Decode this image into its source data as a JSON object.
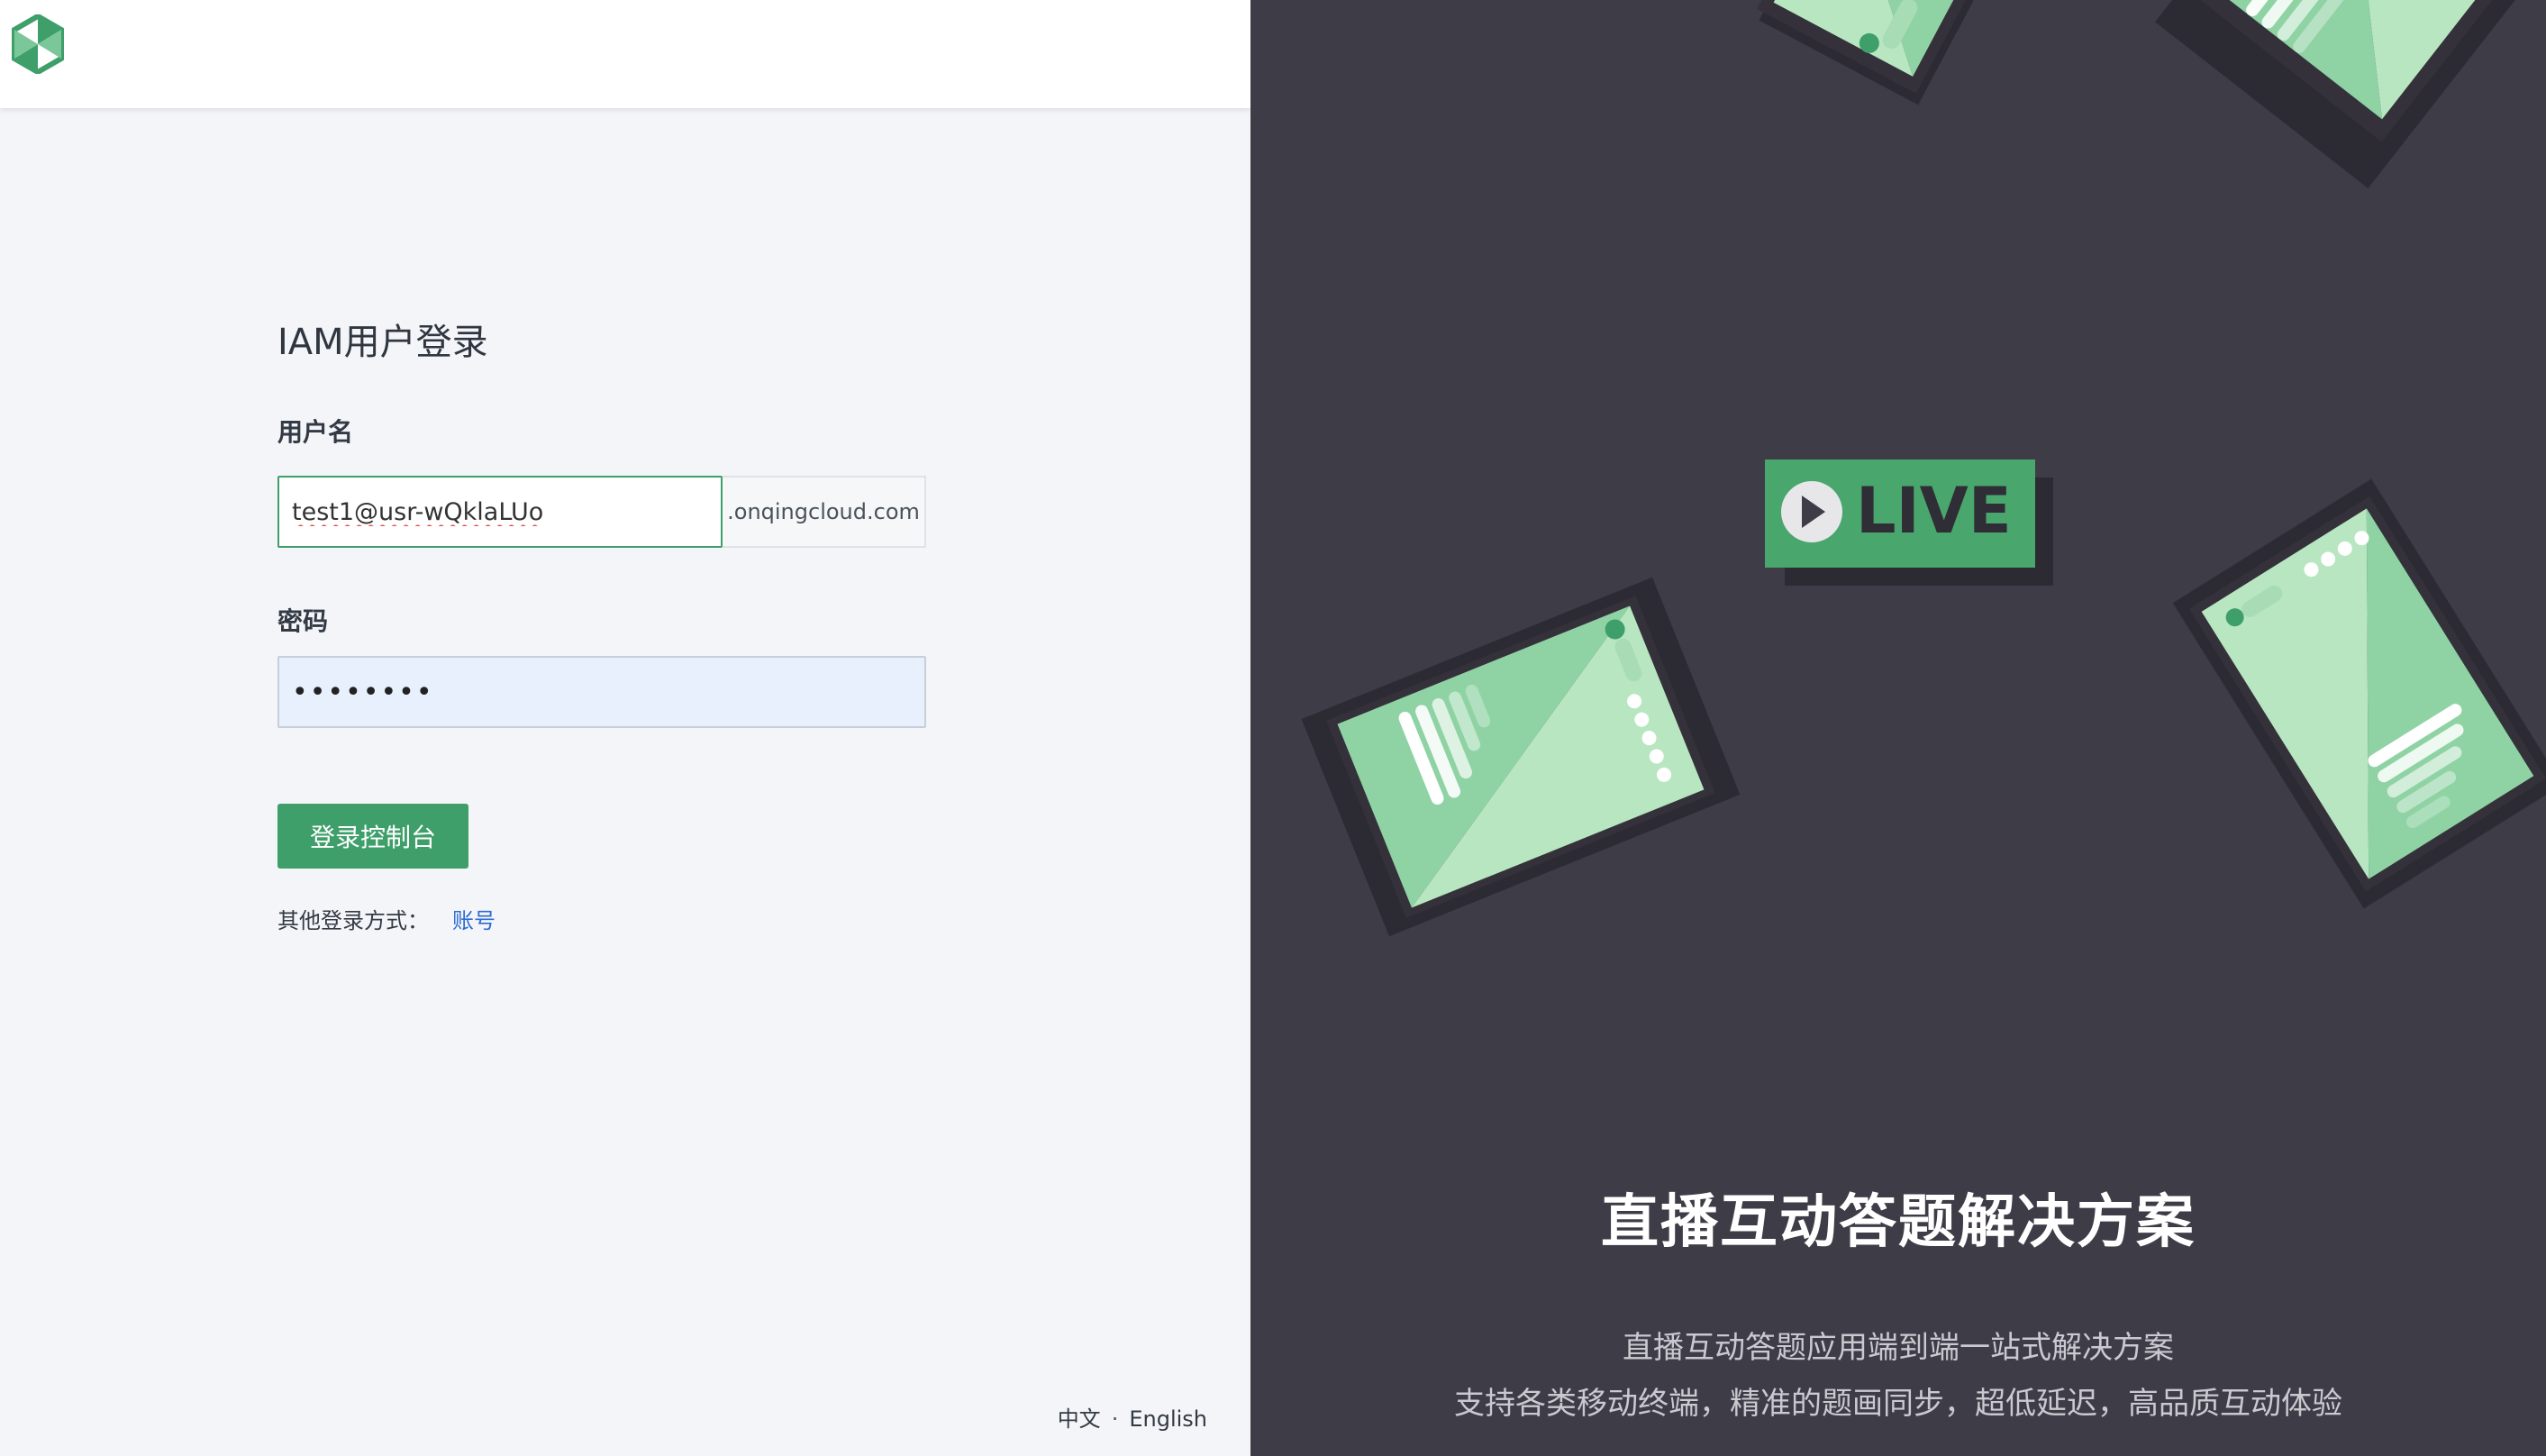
{
  "app": {
    "brand_color": "#3f9f6a"
  },
  "header": {
    "logo_icon": "hexagon-logo-icon"
  },
  "login": {
    "title": "IAM用户登录",
    "username_label": "用户名",
    "username_value": "test1@usr-wQklaLUo",
    "username_suffix": ".onqingcloud.com",
    "password_label": "密码",
    "password_value": "••••••••",
    "submit_label": "登录控制台",
    "other_methods_label": "其他登录方式：",
    "other_methods_link": "账号"
  },
  "footer": {
    "lang_zh": "中文",
    "lang_sep": "·",
    "lang_en": "English"
  },
  "promo": {
    "background_color": "#3e3c47",
    "live_badge": "LIVE",
    "title": "直播互动答题解决方案",
    "line1": "直播互动答题应用端到端一站式解决方案",
    "line2": "支持各类移动终端，精准的题画同步，超低延迟，高品质互动体验"
  }
}
